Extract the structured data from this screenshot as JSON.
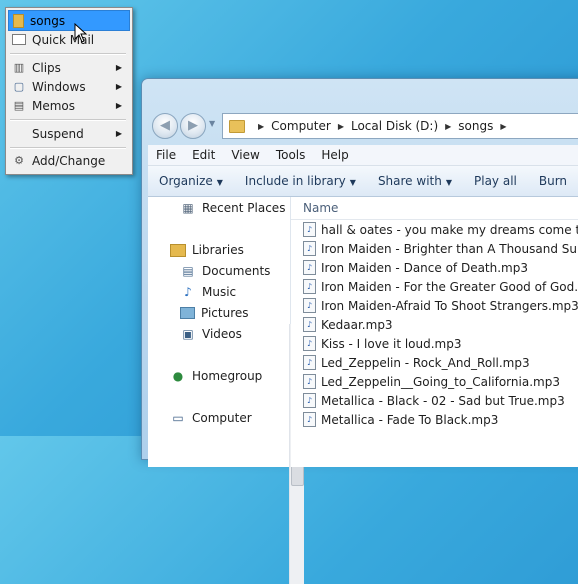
{
  "popup": {
    "items": [
      {
        "label": "songs",
        "icon": "folder-icon",
        "selected": true
      },
      {
        "label": "Quick Mail",
        "icon": "mail-icon"
      },
      {
        "label": "Clips",
        "icon": "clipboard-icon",
        "submenu": true
      },
      {
        "label": "Windows",
        "icon": "window-icon",
        "submenu": true
      },
      {
        "label": "Memos",
        "icon": "notepad-icon",
        "submenu": true
      },
      {
        "label": "Suspend",
        "submenu": true
      },
      {
        "label": "Add/Change",
        "icon": "gear-icon"
      }
    ],
    "arrow": "▶"
  },
  "explorer": {
    "address": {
      "crumbs": [
        "Computer",
        "Local Disk (D:)",
        "songs"
      ]
    },
    "menubar": [
      "File",
      "Edit",
      "View",
      "Tools",
      "Help"
    ],
    "commands": {
      "organize": "Organize",
      "include": "Include in library",
      "share": "Share with",
      "play_all": "Play all",
      "burn": "Burn"
    },
    "nav": {
      "recent": "Recent Places",
      "libraries": "Libraries",
      "documents": "Documents",
      "music": "Music",
      "pictures": "Pictures",
      "videos": "Videos",
      "homegroup": "Homegroup",
      "computer": "Computer"
    },
    "column_header": "Name",
    "files": [
      "hall & oates - you make my dreams come tr",
      "Iron Maiden - Brighter than A Thousand Su",
      "Iron Maiden - Dance of Death.mp3",
      "Iron Maiden - For the Greater Good of God.",
      "Iron Maiden-Afraid To Shoot Strangers.mp3",
      "Kedaar.mp3",
      "Kiss - I love it loud.mp3",
      "Led_Zeppelin - Rock_And_Roll.mp3",
      "Led_Zeppelin__Going_to_California.mp3",
      "Metallica - Black - 02 - Sad but True.mp3",
      "Metallica - Fade To Black.mp3"
    ]
  }
}
